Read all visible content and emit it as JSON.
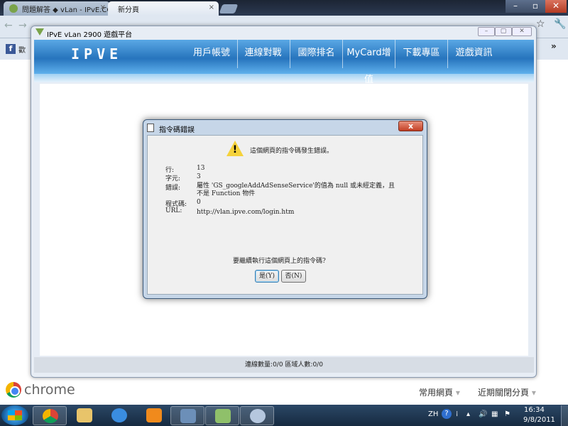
{
  "browser": {
    "tabs": [
      {
        "label": "問題解答 ◆ vLan - IPvE.CO"
      },
      {
        "label": "新分頁"
      }
    ],
    "close_glyph": "×",
    "bookmark_label": "歡",
    "bookmark_more": "»",
    "ntp": {
      "logo_text": "chrome",
      "most_visited": "常用網頁",
      "recently_closed": "近期關閉分頁"
    }
  },
  "app_window": {
    "title": "IPvE vLan 2900 遊戲平台",
    "logo_text": "IPVE",
    "nav": [
      "用戶帳號",
      "連線對戰",
      "國際排名",
      "MyCard增值",
      "下載專區",
      "遊戲資訊"
    ],
    "status": "連線數量:0/0    區域人數:0/0"
  },
  "dialog": {
    "title": "指令碼錯誤",
    "message": "這個網頁的指令碼發生錯誤。",
    "fields": {
      "line_label": "行:",
      "line_value": "13",
      "char_label": "字元:",
      "char_value": "3",
      "error_label": "錯誤:",
      "error_value": "屬性 'GS_googleAddAdSenseService'的值為 null 或未經定義，且不是 Function 物件",
      "code_label": "程式碼:",
      "code_value": "0",
      "url_label": "URL:",
      "url_value": "http://vlan.ipve.com/login.htm"
    },
    "question": "要繼續執行這個網頁上的指令碼?",
    "yes_label": "是(Y)",
    "no_label": "否(N)"
  },
  "taskbar": {
    "lang": "ZH",
    "time": "16:34",
    "date": "9/8/2011"
  },
  "colors": {
    "app_header": "#2774bd",
    "taskbar": "#1c3450",
    "dialog_frame": "#c6d6e8"
  }
}
